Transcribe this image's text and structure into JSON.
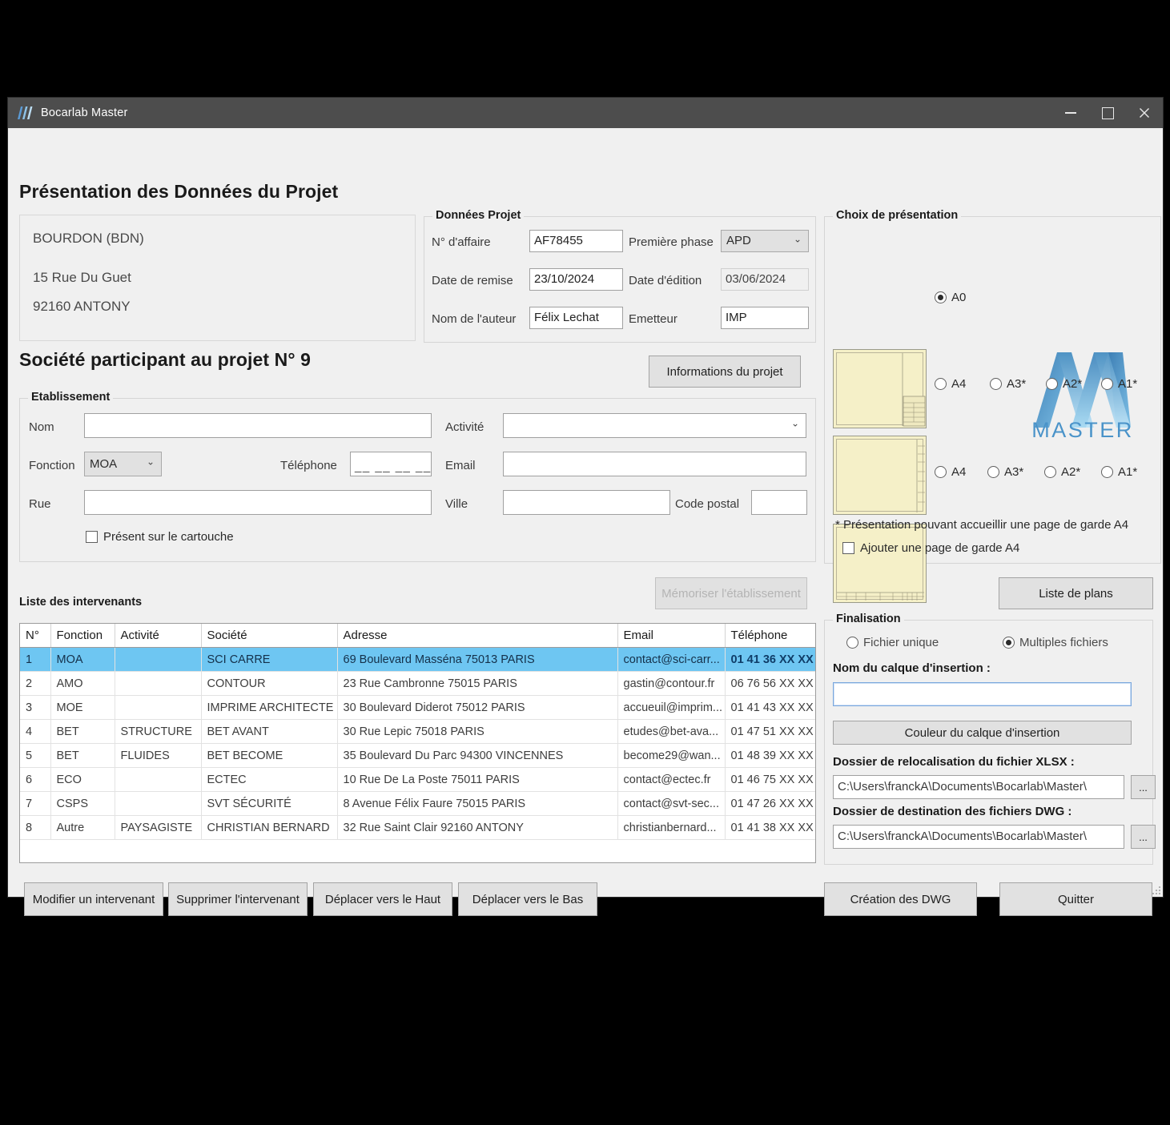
{
  "window": {
    "title": "Bocarlab Master",
    "minimize": "–",
    "maximize": "□",
    "close": "✕"
  },
  "page_title": "Présentation des Données du Projet",
  "address_card": {
    "name": "BOURDON (BDN)",
    "street": "15 Rue Du Guet",
    "city": "92160 ANTONY"
  },
  "project_data": {
    "legend": "Données Projet",
    "affaire_label": "N° d'affaire",
    "affaire_value": "AF78455",
    "phase_label": "Première phase",
    "phase_value": "APD",
    "remise_label": "Date de remise",
    "remise_value": "23/10/2024",
    "edition_label": "Date d'édition",
    "edition_value": "03/06/2024",
    "auteur_label": "Nom de l'auteur",
    "auteur_value": "Félix Lechat",
    "emetteur_label": "Emetteur",
    "emetteur_value": "IMP"
  },
  "society": {
    "heading": "Société participant au projet N° 9",
    "info_button": "Informations du projet"
  },
  "etablissement": {
    "legend": "Etablissement",
    "nom_label": "Nom",
    "nom_value": "",
    "activite_label": "Activité",
    "activite_value": "",
    "fonction_label": "Fonction",
    "fonction_value": "MOA",
    "telephone_label": "Téléphone",
    "telephone_value": "__ __ __ __ __",
    "email_label": "Email",
    "email_value": "",
    "rue_label": "Rue",
    "rue_value": "",
    "ville_label": "Ville",
    "ville_value": "",
    "code_postal_label": "Code postal",
    "code_postal_value": "",
    "cartouche_checkbox": "Présent sur le cartouche",
    "memoriser_button": "Mémoriser l'établissement"
  },
  "presentation": {
    "legend": "Choix de présentation",
    "row1": [
      {
        "label": "A0",
        "selected": true
      }
    ],
    "row2": [
      {
        "label": "A4",
        "selected": false
      },
      {
        "label": "A3*",
        "selected": false
      },
      {
        "label": "A2*",
        "selected": false
      },
      {
        "label": "A1*",
        "selected": false
      }
    ],
    "row3": [
      {
        "label": "A4",
        "selected": false
      },
      {
        "label": "A3*",
        "selected": false
      },
      {
        "label": "A2*",
        "selected": false
      },
      {
        "label": "A1*",
        "selected": false
      }
    ],
    "footnote": "* Présentation pouvant accueillir une page de garde A4",
    "garde_checkbox": "Ajouter une page de garde A4",
    "logo_text": "MASTER",
    "logo_color_dark": "#3d7fb5",
    "logo_color_light": "#9fd3ef"
  },
  "liste_plans_button": "Liste de plans",
  "intervenants": {
    "label": "Liste des intervenants",
    "columns": [
      "N°",
      "Fonction",
      "Activité",
      "Société",
      "Adresse",
      "Email",
      "Téléphone"
    ],
    "rows": [
      {
        "num": "1",
        "fonction": "MOA",
        "activite": "",
        "societe": "SCI CARRE",
        "adresse": "69 Boulevard Masséna 75013 PARIS",
        "email": "contact@sci-carr...",
        "telephone": "01 41 36 XX XX",
        "selected": true
      },
      {
        "num": "2",
        "fonction": "AMO",
        "activite": "",
        "societe": "CONTOUR",
        "adresse": "23 Rue Cambronne 75015 PARIS",
        "email": "gastin@contour.fr",
        "telephone": "06 76 56 XX XX",
        "selected": false
      },
      {
        "num": "3",
        "fonction": "MOE",
        "activite": "",
        "societe": "IMPRIME ARCHITECTE",
        "adresse": "30 Boulevard Diderot 75012 PARIS",
        "email": "accueuil@imprim...",
        "telephone": "01 41 43 XX XX",
        "selected": false
      },
      {
        "num": "4",
        "fonction": "BET",
        "activite": "STRUCTURE",
        "societe": "BET AVANT",
        "adresse": "30 Rue Lepic 75018 PARIS",
        "email": "etudes@bet-ava...",
        "telephone": "01 47 51 XX XX",
        "selected": false
      },
      {
        "num": "5",
        "fonction": "BET",
        "activite": "FLUIDES",
        "societe": "BET BECOME",
        "adresse": "35 Boulevard Du Parc 94300 VINCENNES",
        "email": "become29@wan...",
        "telephone": "01 48 39 XX XX",
        "selected": false
      },
      {
        "num": "6",
        "fonction": "ECO",
        "activite": "",
        "societe": "ECTEC",
        "adresse": "10 Rue De La Poste 75011 PARIS",
        "email": "contact@ectec.fr",
        "telephone": "01 46 75 XX XX",
        "selected": false
      },
      {
        "num": "7",
        "fonction": "CSPS",
        "activite": "",
        "societe": "SVT SÉCURITÉ",
        "adresse": "8 Avenue Félix Faure 75015 PARIS",
        "email": "contact@svt-sec...",
        "telephone": "01 47 26 XX XX",
        "selected": false
      },
      {
        "num": "8",
        "fonction": "Autre",
        "activite": "PAYSAGISTE",
        "societe": "CHRISTIAN BERNARD",
        "adresse": "32 Rue Saint Clair 92160 ANTONY",
        "email": "christianbernard...",
        "telephone": "01 41 38 XX XX",
        "selected": false
      }
    ]
  },
  "finalisation": {
    "legend": "Finalisation",
    "fichier_unique": "Fichier unique",
    "fichier_unique_selected": false,
    "multiples_fichiers": "Multiples fichiers",
    "multiples_fichiers_selected": true,
    "calque_label": "Nom du calque d'insertion :",
    "calque_value": "",
    "couleur_button": "Couleur du calque d'insertion",
    "xlsx_label": "Dossier de relocalisation du fichier XLSX :",
    "xlsx_value": "C:\\Users\\franckA\\Documents\\Bocarlab\\Master\\",
    "xlsx_browse": "...",
    "dwg_label": "Dossier de destination des  fichiers DWG :",
    "dwg_value": "C:\\Users\\franckA\\Documents\\Bocarlab\\Master\\",
    "dwg_browse": "..."
  },
  "bottom_buttons": {
    "modifier": "Modifier un intervenant",
    "supprimer": "Supprimer l'intervenant",
    "haut": "Déplacer vers le Haut",
    "bas": "Déplacer vers le Bas",
    "creation": "Création des DWG",
    "quitter": "Quitter"
  }
}
